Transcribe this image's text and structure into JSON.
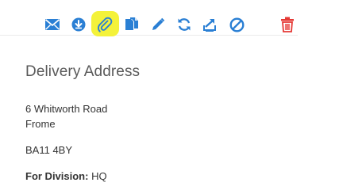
{
  "toolbar": {
    "actions": [
      {
        "icon": "envelope-icon"
      },
      {
        "icon": "download-icon"
      },
      {
        "icon": "paperclip-icon"
      },
      {
        "icon": "copy-icon"
      },
      {
        "icon": "pencil-icon"
      },
      {
        "icon": "refresh-icon"
      },
      {
        "icon": "export-icon"
      },
      {
        "icon": "cancel-icon"
      },
      {
        "icon": "trash-icon"
      }
    ],
    "accent_color": "#2a7fd4",
    "danger_color": "#e53935",
    "highlight_color": "#f4f23a"
  },
  "delivery": {
    "title": "Delivery Address",
    "address_line1": "6 Whitworth Road",
    "address_line2": "Frome",
    "postcode": "BA11 4BY",
    "division_label": "For Division:",
    "division_value": "HQ"
  }
}
